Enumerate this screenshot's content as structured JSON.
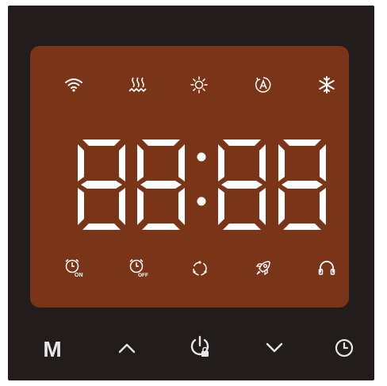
{
  "display": {
    "time_left": "88",
    "time_right": "88",
    "separator": ":",
    "segment_color": "#ffffff",
    "panel_color": "#7a3518"
  },
  "status_icons": {
    "top": [
      "wifi-icon",
      "heating-icon",
      "sun-icon",
      "auto-mode-icon",
      "snowflake-icon"
    ],
    "bottom": [
      "timer-on-icon",
      "timer-off-icon",
      "cycle-icon",
      "rocket-icon",
      "headphones-icon"
    ],
    "timer_on_label": "ON",
    "timer_off_label": "OFF"
  },
  "buttons": {
    "mode_label": "M",
    "icons": [
      "mode-button",
      "up-arrow-icon",
      "power-lock-icon",
      "down-arrow-icon",
      "clock-icon"
    ]
  },
  "colors": {
    "device_bg": "#221c1c",
    "icon_color": "#ffffff",
    "button_color": "#e8e6e6"
  }
}
